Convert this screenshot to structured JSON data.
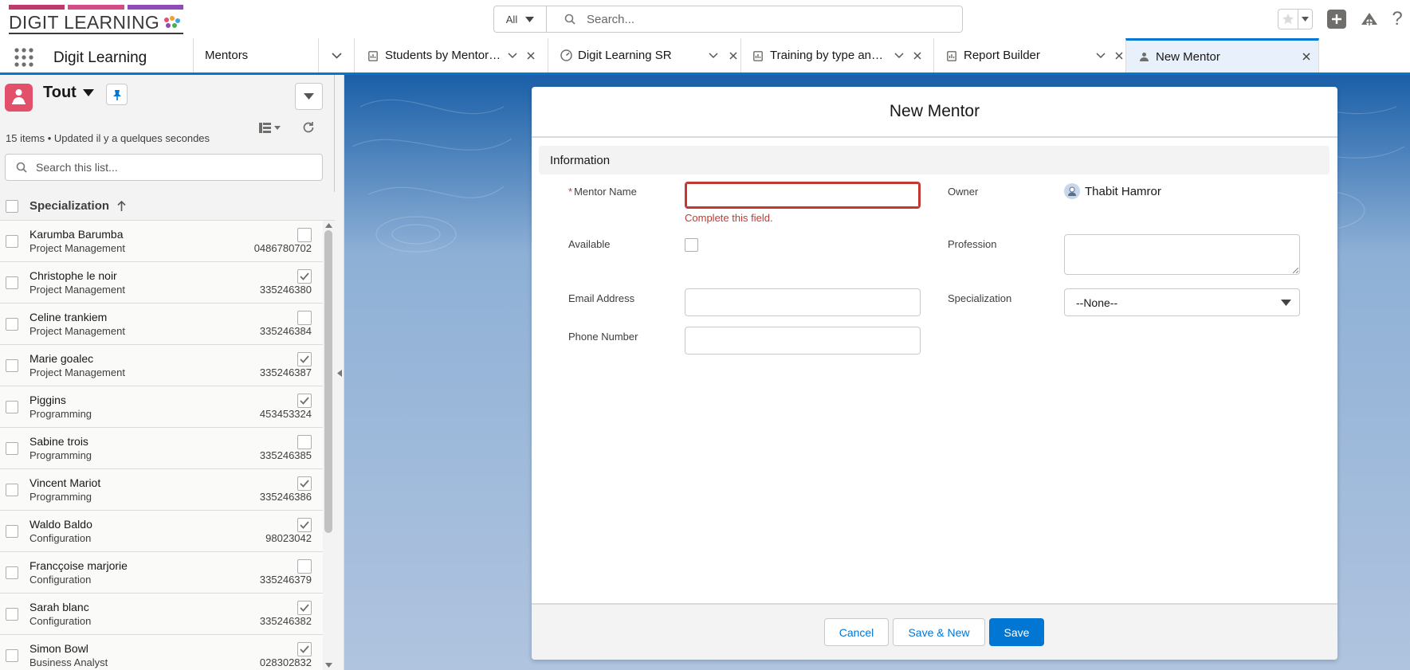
{
  "header": {
    "logo_text": "DIGIT LEARNING",
    "search": {
      "scope": "All",
      "placeholder": "Search..."
    },
    "tools": [
      "favorites-star-icon",
      "add-icon",
      "trailhead-icon",
      "help-icon"
    ]
  },
  "nav": {
    "app_name": "Digit Learning",
    "object_tab": "Mentors",
    "tabs": [
      {
        "label": "Students by Mentor ...",
        "icon": "report-icon"
      },
      {
        "label": "Digit Learning SR",
        "icon": "dashboard-icon"
      },
      {
        "label": "Training by type and...",
        "icon": "report-icon"
      },
      {
        "label": "Report Builder",
        "icon": "report-icon"
      },
      {
        "label": "New Mentor",
        "icon": "mentor-icon",
        "active": true
      }
    ]
  },
  "sidebar": {
    "list_view": "Tout",
    "status": "15 items • Updated il y a quelques secondes",
    "search_placeholder": "Search this list...",
    "sort_column": "Specialization",
    "rows": [
      {
        "name": "Karumba Barumba",
        "spec": "Project Management",
        "phone": "0486780702",
        "available": false
      },
      {
        "name": "Christophe le noir",
        "spec": "Project Management",
        "phone": "335246380",
        "available": true
      },
      {
        "name": "Celine trankiem",
        "spec": "Project Management",
        "phone": "335246384",
        "available": false
      },
      {
        "name": "Marie goalec",
        "spec": "Project Management",
        "phone": "335246387",
        "available": true
      },
      {
        "name": "Piggins",
        "spec": "Programming",
        "phone": "453453324",
        "available": true
      },
      {
        "name": "Sabine trois",
        "spec": "Programming",
        "phone": "335246385",
        "available": false
      },
      {
        "name": "Vincent Mariot",
        "spec": "Programming",
        "phone": "335246386",
        "available": true
      },
      {
        "name": "Waldo Baldo",
        "spec": "Configuration",
        "phone": "98023042",
        "available": true
      },
      {
        "name": "Francçoise marjorie",
        "spec": "Configuration",
        "phone": "335246379",
        "available": false
      },
      {
        "name": "Sarah blanc",
        "spec": "Configuration",
        "phone": "335246382",
        "available": true
      },
      {
        "name": "Simon Bowl",
        "spec": "Business Analyst",
        "phone": "028302832",
        "available": true
      }
    ]
  },
  "modal": {
    "title": "New Mentor",
    "section": "Information",
    "fields": {
      "mentor_name": {
        "label": "Mentor Name",
        "required": "*",
        "value": "",
        "error": "Complete this field."
      },
      "owner": {
        "label": "Owner",
        "value": "Thabit Hamror"
      },
      "available": {
        "label": "Available",
        "checked": false
      },
      "profession": {
        "label": "Profession",
        "value": ""
      },
      "email": {
        "label": "Email Address",
        "value": ""
      },
      "specialization": {
        "label": "Specialization",
        "value": "--None--"
      },
      "phone": {
        "label": "Phone Number",
        "value": ""
      }
    },
    "buttons": {
      "cancel": "Cancel",
      "save_new": "Save & New",
      "save": "Save"
    }
  },
  "colors": {
    "brand": "#0176d3",
    "error": "#c23934",
    "object_icon": "#e3506b"
  }
}
